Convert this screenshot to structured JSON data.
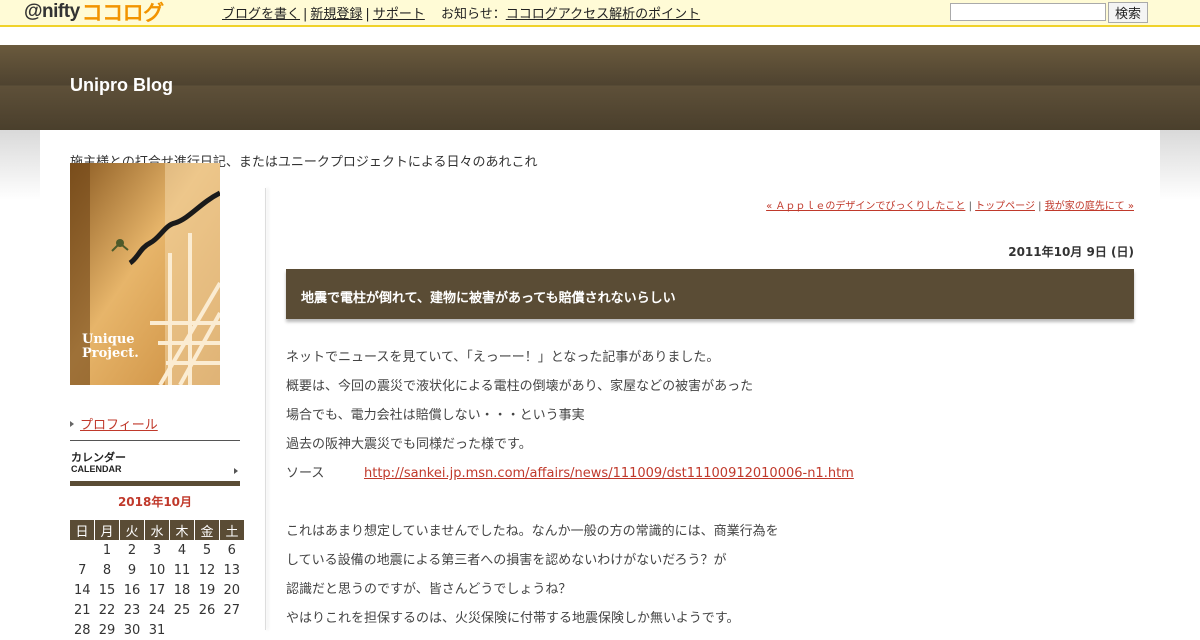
{
  "topbar": {
    "logo_at": "@nifty",
    "logo_koko": "ココログ",
    "links": [
      "ブログを書く",
      "新規登録",
      "サポート"
    ],
    "notice_label": "お知らせ",
    "notice_sep": "：",
    "notice_link": "ココログアクセス解析のポイント",
    "search_placeholder": "",
    "search_button": "検索"
  },
  "header": {
    "blog_title": "Unipro Blog"
  },
  "tagline": "施主様との打合せ進行日記、またはユニークプロジェクトによる日々のあれこれ",
  "sidebar": {
    "photo_caption": "Unique Project.",
    "profile_link": "プロフィール",
    "calendar_title_ja": "カレンダー",
    "calendar_title_en": "CALENDAR",
    "calendar_month": "2018年10月",
    "weekdays": [
      "日",
      "月",
      "火",
      "水",
      "木",
      "金",
      "土"
    ],
    "weeks": [
      [
        "",
        "1",
        "2",
        "3",
        "4",
        "5",
        "6"
      ],
      [
        "7",
        "8",
        "9",
        "10",
        "11",
        "12",
        "13"
      ],
      [
        "14",
        "15",
        "16",
        "17",
        "18",
        "19",
        "20"
      ],
      [
        "21",
        "22",
        "23",
        "24",
        "25",
        "26",
        "27"
      ],
      [
        "28",
        "29",
        "30",
        "31",
        "",
        "",
        ""
      ]
    ]
  },
  "nav": {
    "prev": "« Ａｐｐｌｅのデザインでびっくりしたこと",
    "top": "トップページ",
    "next": "我が家の庭先にて »",
    "sep": "|"
  },
  "post": {
    "date": "2011年10月 9日 (日)",
    "title": "地震で電柱が倒れて、建物に被害があっても賠償されないらしい",
    "lines_1": [
      "ネットでニュースを見ていて、「えっーー！」となった記事がありました。",
      "概要は、今回の震災で液状化による電柱の倒壊があり、家屋などの被害があった",
      "場合でも、電力会社は賠償しない・・・という事実",
      "過去の阪神大震災でも同様だった様です。"
    ],
    "source_label": "ソース",
    "source_url": "http://sankei.jp.msn.com/affairs/news/111009/dst11100912010006-n1.htm",
    "lines_2": [
      "これはあまり想定していませんでしたね。なんか一般の方の常識的には、商業行為を",
      "している設備の地震による第三者への損害を認めないわけがないだろう？が",
      "認識だと思うのですが、皆さんどうでしょうね？",
      "やはりこれを担保するのは、火災保険に付帯する地震保険しか無いようです。"
    ]
  },
  "colors": {
    "topbar_bg": "#fffbd6",
    "topbar_border": "#f0d22a",
    "header_bg": "#4f4330",
    "title_bar_bg": "#5a4c35",
    "link": "#c0392b",
    "logo_orange": "#f29400"
  }
}
